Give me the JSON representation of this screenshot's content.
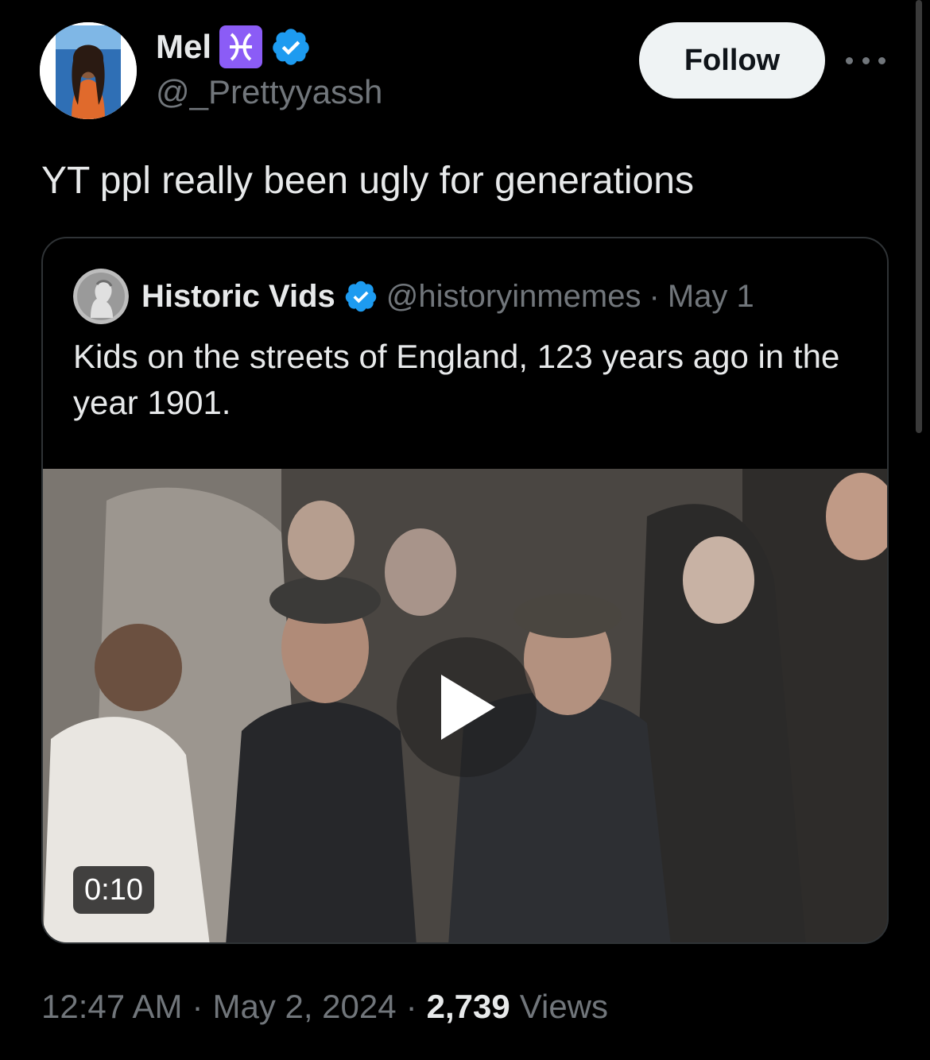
{
  "author": {
    "name": "Mel",
    "emoji": "♓",
    "handle": "@_Prettyyassh",
    "verified_icon": "verified-badge-icon"
  },
  "follow_label": "Follow",
  "tweet_text": "YT ppl really been ugly for generations",
  "quote": {
    "name": "Historic Vids",
    "handle": "@historyinmemes",
    "separator": "·",
    "date": "May 1",
    "text": "Kids on the streets of England, 123 years ago in the year 1901.",
    "video_duration": "0:10"
  },
  "meta": {
    "time": "12:47 AM",
    "sep1": "·",
    "date": "May 2, 2024",
    "sep2": "·",
    "views_count": "2,739",
    "views_label": "Views"
  },
  "colors": {
    "background": "#000000",
    "text": "#e7e9ea",
    "muted": "#71767b",
    "verified": "#1d9bf0",
    "border": "#2f3336"
  }
}
